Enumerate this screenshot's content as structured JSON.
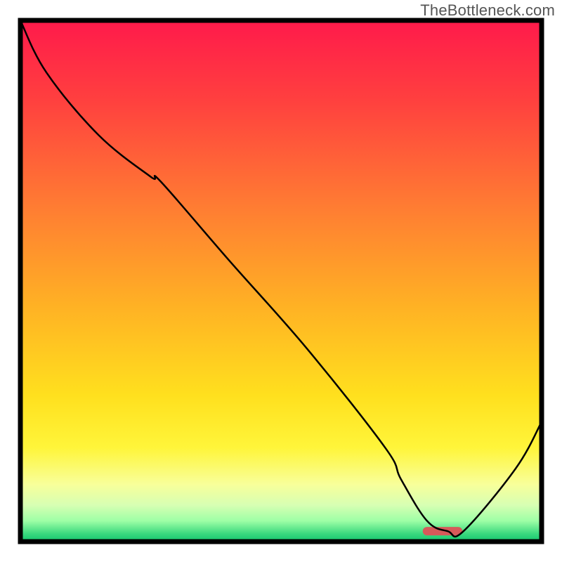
{
  "watermark": "TheBottleneck.com",
  "chart_data": {
    "type": "line",
    "title": "",
    "xlabel": "",
    "ylabel": "",
    "xlim": [
      0,
      100
    ],
    "ylim": [
      0,
      100
    ],
    "grid": false,
    "legend": false,
    "series": [
      {
        "name": "bottleneck-curve",
        "x": [
          0,
          5,
          15,
          25,
          27,
          40,
          55,
          70,
          73,
          78,
          82,
          85,
          95,
          100
        ],
        "y": [
          100,
          90,
          78,
          70,
          69,
          54,
          37,
          18,
          12,
          4,
          2,
          2,
          14,
          23
        ],
        "color": "#000000",
        "stroke_width": 2.5
      }
    ],
    "marker": {
      "name": "optimal-zone",
      "x_start": 78,
      "x_end": 84,
      "y": 2,
      "color": "#d65a5a",
      "thickness": 12
    },
    "background_gradient": {
      "stops": [
        {
          "offset": 0.0,
          "color": "#ff1a4b"
        },
        {
          "offset": 0.15,
          "color": "#ff3f3f"
        },
        {
          "offset": 0.35,
          "color": "#ff7a33"
        },
        {
          "offset": 0.55,
          "color": "#ffb224"
        },
        {
          "offset": 0.72,
          "color": "#ffe01e"
        },
        {
          "offset": 0.82,
          "color": "#fff53a"
        },
        {
          "offset": 0.89,
          "color": "#f8ff9a"
        },
        {
          "offset": 0.93,
          "color": "#d7ffb3"
        },
        {
          "offset": 0.96,
          "color": "#9effa6"
        },
        {
          "offset": 0.985,
          "color": "#3ad97e"
        },
        {
          "offset": 1.0,
          "color": "#11c66e"
        }
      ]
    },
    "frame_color": "#000000"
  }
}
